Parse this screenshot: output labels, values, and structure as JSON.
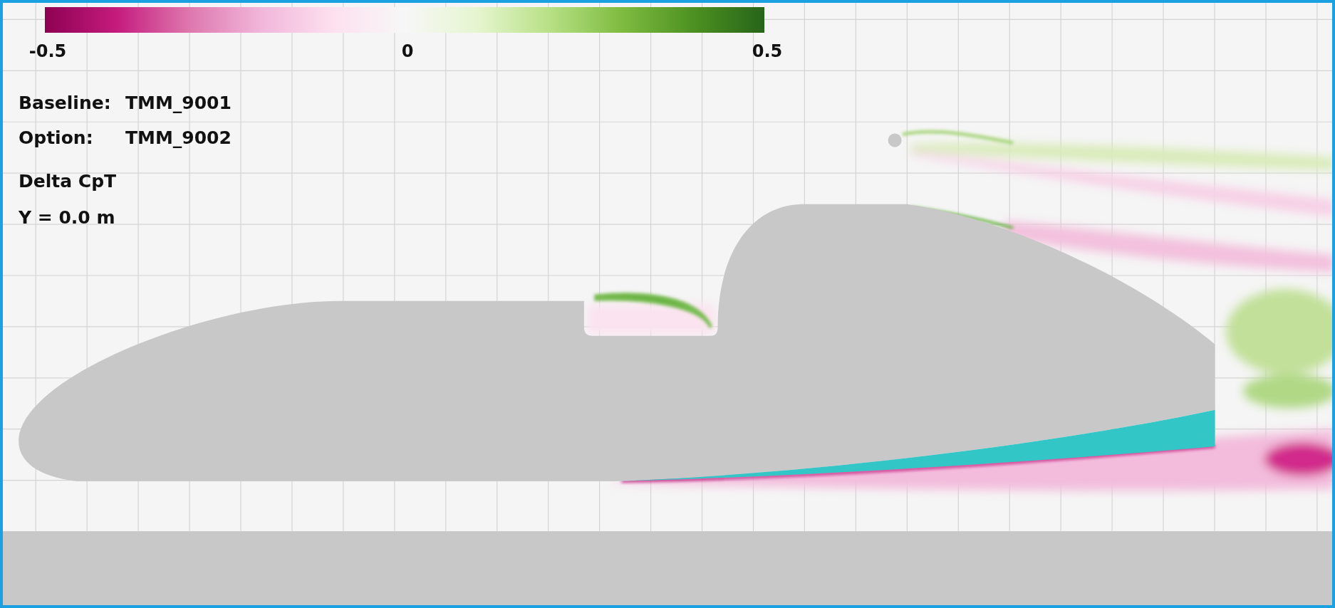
{
  "colorbar": {
    "min_label": "-0.5",
    "mid_label": "0",
    "max_label": "0.5"
  },
  "info": [
    {
      "kind": "pair",
      "label": "Baseline:",
      "value": "TMM_9001"
    },
    {
      "kind": "pair",
      "label": "Option:",
      "value": "TMM_9002"
    },
    {
      "kind": "line",
      "text": "Delta CpT"
    },
    {
      "kind": "line",
      "text": "Y = 0.0 m"
    }
  ]
}
